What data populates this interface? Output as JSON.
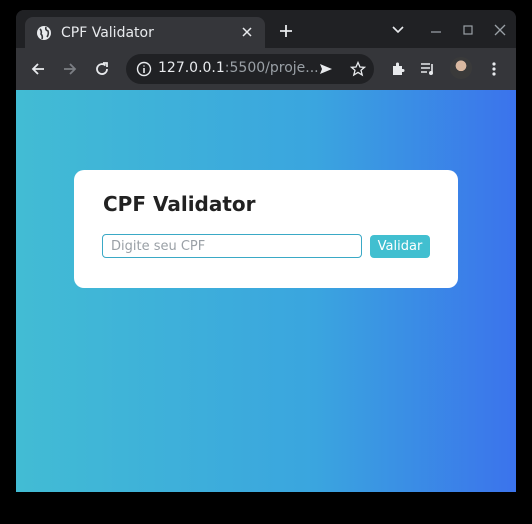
{
  "browser": {
    "tab": {
      "title": "CPF Validator",
      "favicon": "globe-icon"
    },
    "address": {
      "host": "127.0.0.1",
      "rest": ":5500/proje..."
    },
    "icons": [
      "back-arrow-icon",
      "forward-arrow-icon",
      "reload-icon",
      "info-icon",
      "send-icon",
      "star-icon",
      "extensions-icon",
      "media-queue-icon",
      "profile-avatar",
      "more-menu-icon"
    ],
    "colors": {
      "frame": "#202124",
      "toolbar": "#35363a"
    }
  },
  "page": {
    "title": "CPF Validator",
    "input_placeholder": "Digite seu CPF",
    "input_value": "",
    "button_label": "Validar",
    "colors": {
      "gradient_start": "#42bcd4",
      "gradient_end": "#3b73ec",
      "button": "#41bfd0",
      "input_border": "#3aa9c6"
    }
  }
}
